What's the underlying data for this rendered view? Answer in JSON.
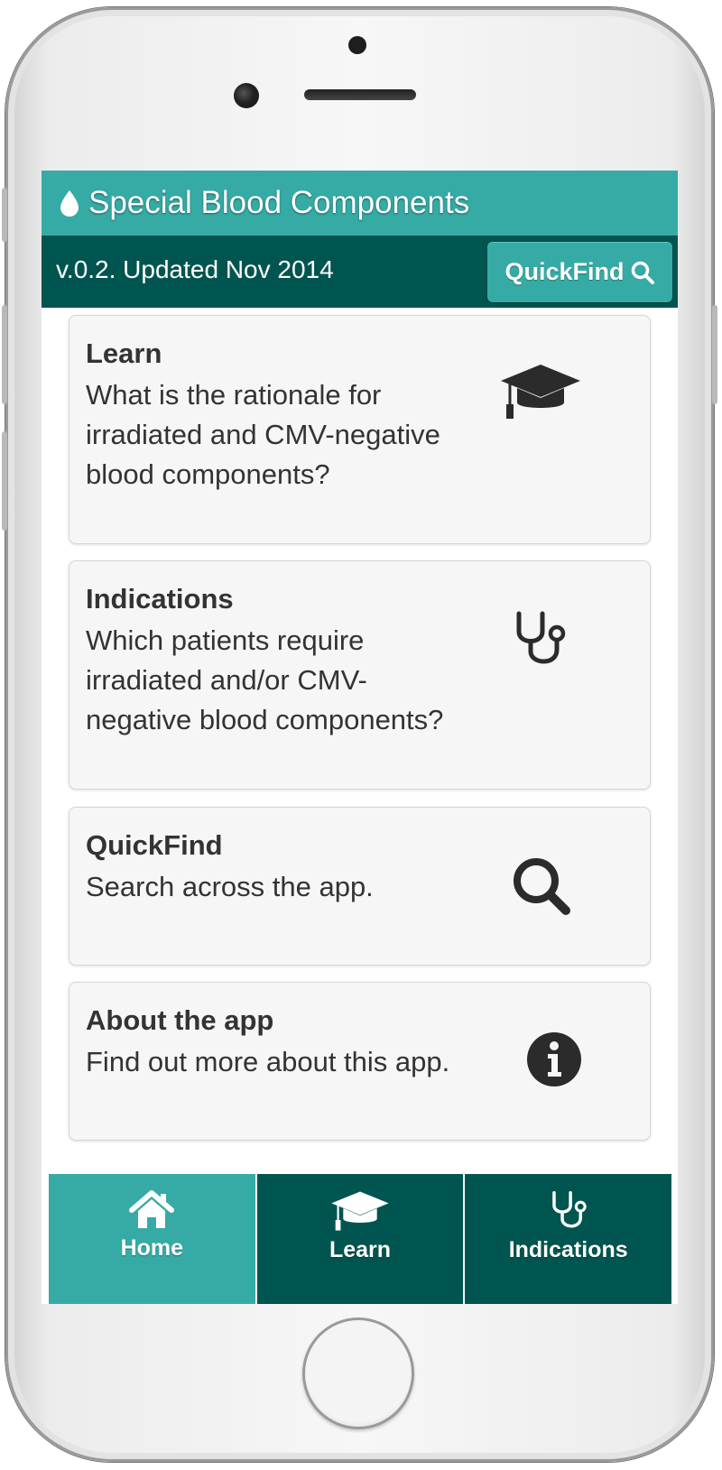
{
  "header": {
    "title": "Special Blood Components",
    "version": "v.0.2. Updated Nov 2014",
    "quickfind_label": "QuickFind",
    "icons": {
      "title_icon": "blood-drop-icon",
      "quickfind_icon": "search-icon"
    }
  },
  "cards": [
    {
      "title": "Learn",
      "description": "What is the rationale for irradiated and CMV-negative blood components?",
      "icon": "graduation-cap-icon"
    },
    {
      "title": "Indications",
      "description": "Which patients require irradiated and/or CMV-negative blood components?",
      "icon": "stethoscope-icon"
    },
    {
      "title": "QuickFind",
      "description": "Search across the app.",
      "icon": "search-icon"
    },
    {
      "title": "About the app",
      "description": "Find out more about this app.",
      "icon": "info-icon"
    }
  ],
  "tabs": [
    {
      "label": "Home",
      "icon": "home-icon",
      "active": true
    },
    {
      "label": "Learn",
      "icon": "graduation-cap-icon",
      "active": false
    },
    {
      "label": "Indications",
      "icon": "stethoscope-icon",
      "active": false
    }
  ],
  "colors": {
    "header_teal": "#36aba6",
    "dark_teal": "#005550",
    "card_bg": "#f6f6f6",
    "text": "#333333"
  }
}
